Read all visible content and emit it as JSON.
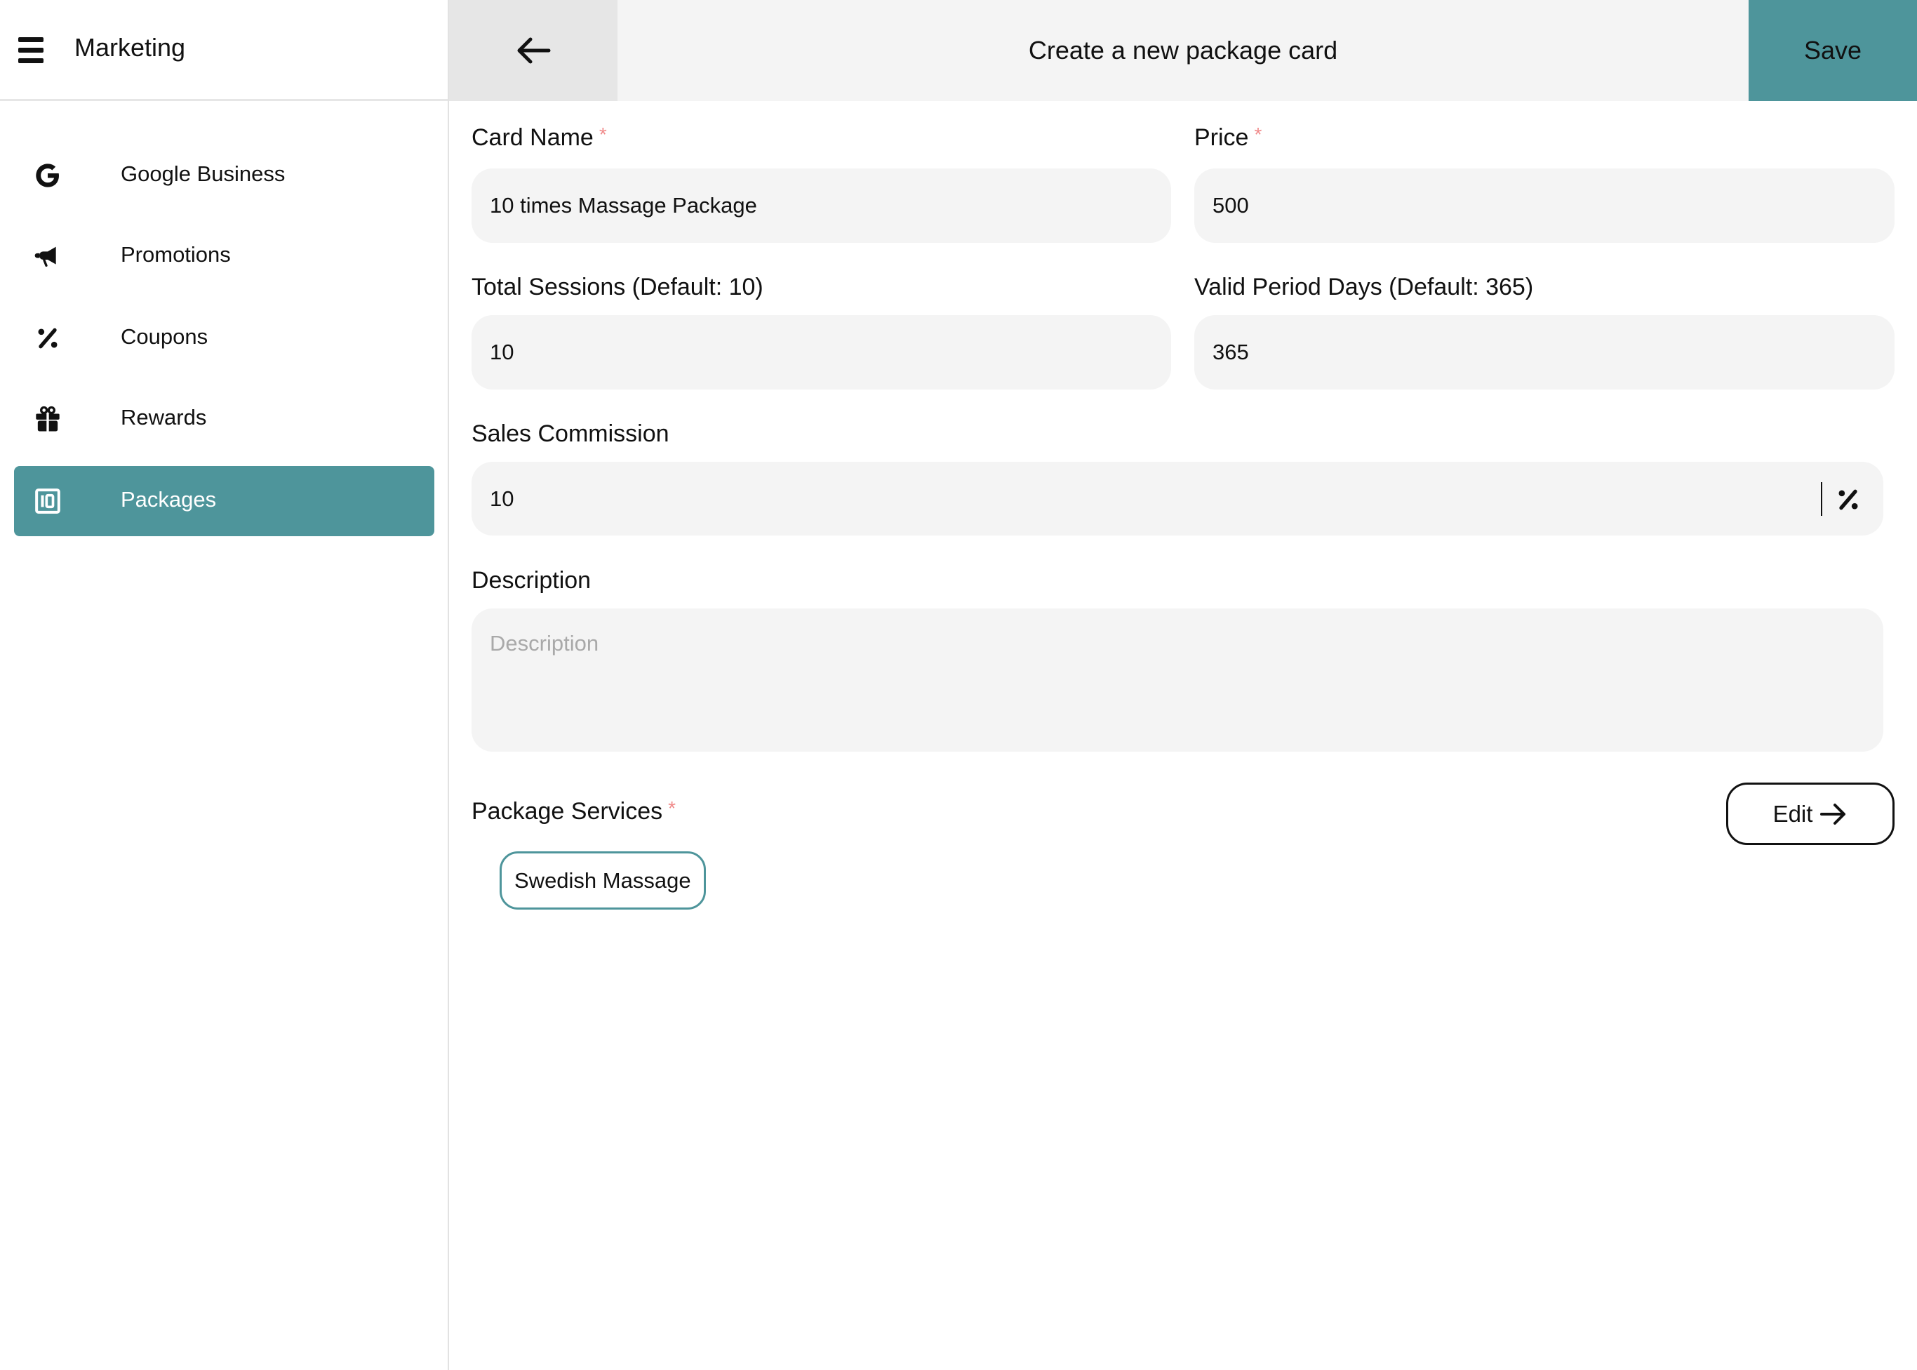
{
  "sidebar": {
    "title": "Marketing",
    "menu_icon": "hamburger-menu-icon",
    "items": [
      {
        "label": "Google Business",
        "icon": "google-icon",
        "active": false
      },
      {
        "label": "Promotions",
        "icon": "megaphone-icon",
        "active": false
      },
      {
        "label": "Coupons",
        "icon": "percent-icon",
        "active": false
      },
      {
        "label": "Rewards",
        "icon": "gift-icon",
        "active": false
      },
      {
        "label": "Packages",
        "icon": "package-10-icon",
        "active": true
      }
    ]
  },
  "header": {
    "back_icon": "arrow-left-icon",
    "title": "Create a new package card",
    "save_label": "Save"
  },
  "form": {
    "card_name": {
      "label": "Card Name",
      "required": "*",
      "value": "10 times Massage Package"
    },
    "price": {
      "label": "Price",
      "required": "*",
      "value": "500"
    },
    "total_sessions": {
      "label": "Total Sessions (Default: 10)",
      "value": "10"
    },
    "valid_period": {
      "label": "Valid Period Days (Default: 365)",
      "value": "365"
    },
    "sales_commission": {
      "label": "Sales Commission",
      "value": "10",
      "suffix_icon": "percent-icon"
    },
    "description": {
      "label": "Description",
      "value": "",
      "placeholder": "Description"
    },
    "package_services": {
      "label": "Package Services",
      "required": "*",
      "edit_label": "Edit",
      "edit_icon": "arrow-right-icon",
      "services": [
        "Swedish Massage"
      ]
    }
  },
  "colors": {
    "accent": "#4e959b",
    "input_bg": "#f4f4f4",
    "header_bg": "#f4f4f4",
    "back_bg": "#e6e6e6",
    "required": "#f08a8a"
  }
}
